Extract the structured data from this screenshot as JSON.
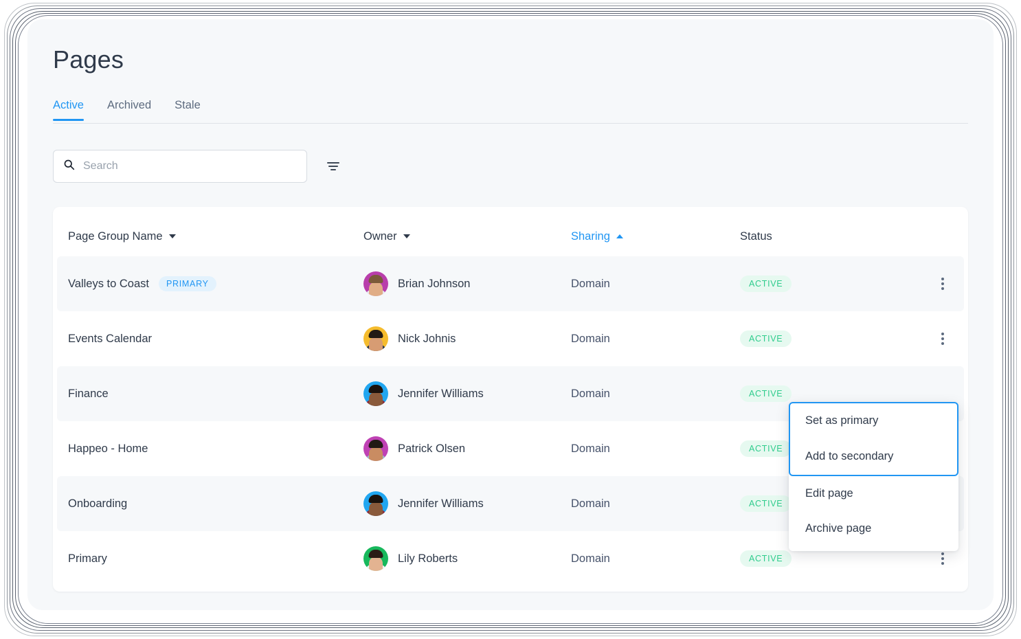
{
  "page": {
    "title": "Pages"
  },
  "tabs": [
    {
      "label": "Active",
      "active": true
    },
    {
      "label": "Archived",
      "active": false
    },
    {
      "label": "Stale",
      "active": false
    }
  ],
  "search": {
    "placeholder": "Search",
    "value": "",
    "icon": "search-icon"
  },
  "filter": {
    "icon": "filter-icon"
  },
  "table": {
    "columns": [
      {
        "label": "Page Group Name",
        "sort": "down",
        "sorted": false
      },
      {
        "label": "Owner",
        "sort": "down",
        "sorted": false
      },
      {
        "label": "Sharing",
        "sort": "up",
        "sorted": true
      },
      {
        "label": "Status",
        "sort": "none",
        "sorted": false
      }
    ],
    "rows": [
      {
        "name": "Valleys to Coast",
        "badge": "PRIMARY",
        "owner": "Brian Johnson",
        "avatar_bg": "#b83eab",
        "avatar_hair": "#7b5a3a",
        "avatar_skin": "#e0ad86",
        "avatar_body": "#e7e9ee",
        "sharing": "Domain",
        "status": "ACTIVE",
        "menu_visible": true
      },
      {
        "name": "Events Calendar",
        "badge": "",
        "owner": "Nick Johnis",
        "avatar_bg": "#f5bc2e",
        "avatar_hair": "#221a14",
        "avatar_skin": "#d79c73",
        "avatar_body": "#2e3a4e",
        "sharing": "Domain",
        "status": "ACTIVE",
        "menu_visible": true
      },
      {
        "name": "Finance",
        "badge": "",
        "owner": "Jennifer Williams",
        "avatar_bg": "#21a6f0",
        "avatar_hair": "#1b120d",
        "avatar_skin": "#8a5a3b",
        "avatar_body": "#8e2b38",
        "sharing": "Domain",
        "status": "ACTIVE",
        "menu_visible": false
      },
      {
        "name": "Happeo - Home",
        "badge": "",
        "owner": "Patrick Olsen",
        "avatar_bg": "#bf42b4",
        "avatar_hair": "#221a14",
        "avatar_skin": "#c98c62",
        "avatar_body": "#9db7c6",
        "sharing": "Domain",
        "status": "ACTIVE",
        "menu_visible": false
      },
      {
        "name": "Onboarding",
        "badge": "",
        "owner": "Jennifer Williams",
        "avatar_bg": "#21a6f0",
        "avatar_hair": "#1b120d",
        "avatar_skin": "#8a5a3b",
        "avatar_body": "#8e2b38",
        "sharing": "Domain",
        "status": "ACTIVE",
        "menu_visible": false
      },
      {
        "name": "Primary",
        "badge": "",
        "owner": "Lily Roberts",
        "avatar_bg": "#18b85c",
        "avatar_hair": "#2b1d16",
        "avatar_skin": "#e3b391",
        "avatar_body": "#f2f4f7",
        "sharing": "Domain",
        "status": "ACTIVE",
        "menu_visible": true
      }
    ]
  },
  "context_menu": {
    "focused_items": [
      {
        "label": "Set as primary"
      },
      {
        "label": "Add to secondary"
      }
    ],
    "items": [
      {
        "label": "Edit page"
      },
      {
        "label": "Archive page"
      }
    ]
  },
  "colors": {
    "accent": "#2196f3",
    "text": "#2f3a4a",
    "muted": "#5d6b7f",
    "status_green": "#2ecc8c",
    "status_green_bg": "#e6f9f0",
    "badge_blue_bg": "#e3f2fd",
    "page_bg": "#f6f8fa",
    "card_bg": "#ffffff"
  }
}
